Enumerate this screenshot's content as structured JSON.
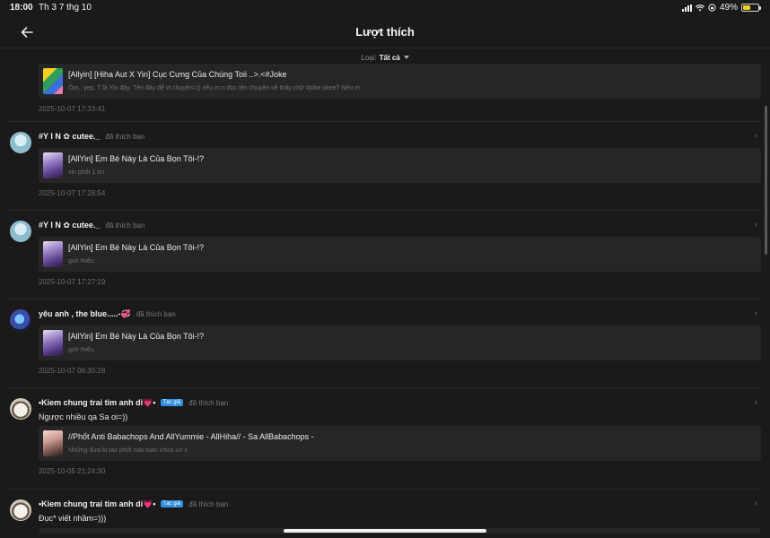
{
  "status": {
    "time": "18:00",
    "date": "Th 3 7 thg 10",
    "battery_pct": "49%",
    "battery_level": 0.49
  },
  "header": {
    "title": "Lượt thích"
  },
  "filter": {
    "label": "Loại:",
    "value": "Tất cả"
  },
  "items": [
    {
      "card": {
        "title": "[Allyin] [Hiha Aut X Yin] Cục Cưng Của Chúng Toii ..>.<#Joke",
        "subtitle": "Ôm.. yep, T là Yin đây. Tên đây để vt chuyện=)) nếu m.n đọc tên chuyện sẽ thấy chữ #joke okee? Nếu m"
      },
      "timestamp": "2025-10-07 17:33:41"
    },
    {
      "user": "#Y I N ✿ cutee._",
      "action": "đã thích bạn",
      "card": {
        "title": "[AllYin] Em Bé Này Là Của Bọn Tôi-!?",
        "subtitle": "xin phốt 1 bn"
      },
      "timestamp": "2025-10-07 17:28:54"
    },
    {
      "user": "#Y I N ✿ cutee._",
      "action": "đã thích bạn",
      "card": {
        "title": "[AllYin] Em Bé Này Là Của Bọn Tôi-!?",
        "subtitle": "giới thiệu"
      },
      "timestamp": "2025-10-07 17:27:19"
    },
    {
      "user": "yêu anh , the blue.....-💞",
      "action": "đã thích bạn",
      "card": {
        "title": "[AllYin] Em Bé Này Là Của Bọn Tôi-!?",
        "subtitle": "giới thiệu"
      },
      "timestamp": "2025-10-07 06:30:28"
    },
    {
      "user": "•Kiem chung trai tim anh di💗•",
      "badge": "Tác giả",
      "action": "đã thích bạn",
      "comment": "Ngược nhiều qa Sa oi=))",
      "card": {
        "title": "//Phốt Anti Babachops And AllYummie - AllHiha// - Sa AllBabachops -",
        "subtitle": "Những đứa bị tao phốt nào toàn chưa cứ c"
      },
      "timestamp": "2025-10-05 21:24:30"
    },
    {
      "user": "•Kiem chung trai tim anh di💗•",
      "badge": "Tác giả",
      "action": "đã thích bạn",
      "comment": "Đục* viết nhầm=)))"
    }
  ],
  "icons": {
    "back": "arrow-left-icon",
    "chevron": "chevron-right-icon",
    "caret": "caret-down-icon"
  },
  "colors": {
    "background": "#1a1a1b",
    "card": "#262627",
    "badge": "#2e8fe0"
  }
}
